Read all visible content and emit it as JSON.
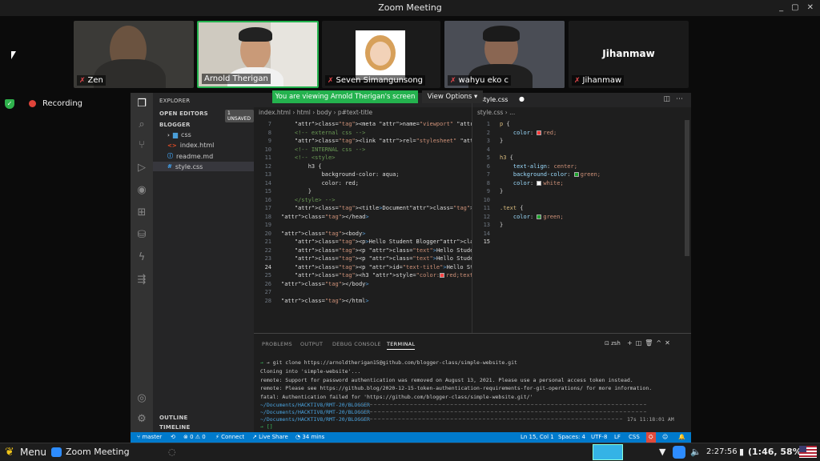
{
  "window": {
    "title": "Zoom Meeting",
    "controls": [
      "_",
      "▢",
      "✕"
    ]
  },
  "participants": [
    {
      "name": "Zen",
      "muted": true
    },
    {
      "name": "Arnold Therigan",
      "muted": false,
      "active": true
    },
    {
      "name": "Seven Simangunsong",
      "muted": true
    },
    {
      "name": "wahyu eko c",
      "muted": true
    },
    {
      "name": "Jihanmaw",
      "muted": true,
      "avatar_text": "Jihanmaw"
    }
  ],
  "recording": {
    "label": "Recording"
  },
  "share": {
    "banner": "You are viewing Arnold Therigan's screen",
    "view_options": "View Options"
  },
  "vscode": {
    "explorer_title": "EXPLORER",
    "open_editors": "OPEN EDITORS",
    "unsaved_badge": "1 UNSAVED",
    "folder": "BLOGGER",
    "files": [
      {
        "name": "css",
        "icon": "›",
        "type": "folder"
      },
      {
        "name": "index.html",
        "icon": "<>",
        "type": "html"
      },
      {
        "name": "readme.md",
        "icon": "ⓘ",
        "type": "md"
      },
      {
        "name": "style.css",
        "icon": "#",
        "type": "css"
      }
    ],
    "outline": "OUTLINE",
    "timeline": "TIMELINE",
    "left_breadcrumb": "index.html › html › body › p#text-title",
    "right_tab": "style.css",
    "right_breadcrumb": "style.css › ...",
    "html_lines": [
      {
        "n": "7",
        "code": "    <meta name=\"viewport\" content=\"width=device-width, i"
      },
      {
        "n": "8",
        "code": "    <!-- external css -->"
      },
      {
        "n": "9",
        "code": "    <link rel=\"stylesheet\" href=\"./style.css\">"
      },
      {
        "n": "10",
        "code": "    <!-- INTERNAL css -->"
      },
      {
        "n": "11",
        "code": "    <!-- <style>"
      },
      {
        "n": "12",
        "code": "        h3 {"
      },
      {
        "n": "13",
        "code": "            background-color: aqua;"
      },
      {
        "n": "14",
        "code": "            color: red;"
      },
      {
        "n": "15",
        "code": "        }"
      },
      {
        "n": "16",
        "code": "    </style> -->"
      },
      {
        "n": "17",
        "code": "    <title>Document</title>"
      },
      {
        "n": "18",
        "code": "</head>"
      },
      {
        "n": "19",
        "code": ""
      },
      {
        "n": "20",
        "code": "<body>"
      },
      {
        "n": "21",
        "code": "    <p>Hello Student Blogger</p>"
      },
      {
        "n": "22",
        "code": "    <p class=\"text\">Hello Student 2</p>"
      },
      {
        "n": "23",
        "code": "    <p class=\"text\">Hello Student 3</p>"
      },
      {
        "n": "24",
        "code": "    <p id=\"text-title\">Hello Student 4</p>"
      },
      {
        "n": "25",
        "code": "    <h3 style=\"color:■red;text-align: center;\">Belajar"
      },
      {
        "n": "26",
        "code": "</body>"
      },
      {
        "n": "27",
        "code": ""
      },
      {
        "n": "28",
        "code": "</html>"
      }
    ],
    "css_lines": [
      {
        "n": "1",
        "code": "p {"
      },
      {
        "n": "2",
        "code": "    color: ■red;"
      },
      {
        "n": "3",
        "code": "}"
      },
      {
        "n": "4",
        "code": ""
      },
      {
        "n": "5",
        "code": "h3 {"
      },
      {
        "n": "6",
        "code": "    text-align: center;"
      },
      {
        "n": "7",
        "code": "    background-color: ■green;"
      },
      {
        "n": "8",
        "code": "    color: ■white;"
      },
      {
        "n": "9",
        "code": "}"
      },
      {
        "n": "10",
        "code": ""
      },
      {
        "n": "11",
        "code": ".text {"
      },
      {
        "n": "12",
        "code": "    color: ■green;"
      },
      {
        "n": "13",
        "code": "}"
      },
      {
        "n": "14",
        "code": ""
      },
      {
        "n": "15",
        "code": ""
      }
    ],
    "panel_tabs": [
      "PROBLEMS",
      "OUTPUT",
      "DEBUG CONSOLE",
      "TERMINAL"
    ],
    "terminal_shell": "zsh",
    "terminal_lines": [
      "→ git clone https://arnoldtherigan15@github.com/blogger-class/simple-website.git",
      "Cloning into 'simple-website'...",
      "remote: Support for password authentication was removed on August 13, 2021. Please use a personal access token instead.",
      "remote: Please see https://github.blog/2020-12-15-token-authentication-requirements-for-git-operations/ for more information.",
      "fatal: Authentication failed for 'https://github.com/blogger-class/simple-website.git/'",
      "~/Documents/HACKTIV8/RMT-20/BLOGGER",
      "~/Documents/HACKTIV8/RMT-20/BLOGGER",
      "~/Documents/HACKTIV8/RMT-20/BLOGGER",
      "→ []"
    ],
    "terminal_time": "17s 11:18:01 AM",
    "status": {
      "branch": "master",
      "problems": "⊗ 0 ⚠ 0",
      "connect": "Connect",
      "liveshare": "Live Share",
      "time": "34 mins",
      "position": "Ln 15, Col 1",
      "spaces": "Spaces: 4",
      "encoding": "UTF-8",
      "eol": "LF",
      "lang": "CSS"
    }
  },
  "taskbar": {
    "menu": "Menu",
    "app": "Zoom Meeting",
    "clock": "2:27:56",
    "battery": "(1:46, 58%)"
  },
  "colors": {
    "share_green": "#24b24e",
    "vscode_blue": "#007acc",
    "active_border": "#24b24e"
  }
}
